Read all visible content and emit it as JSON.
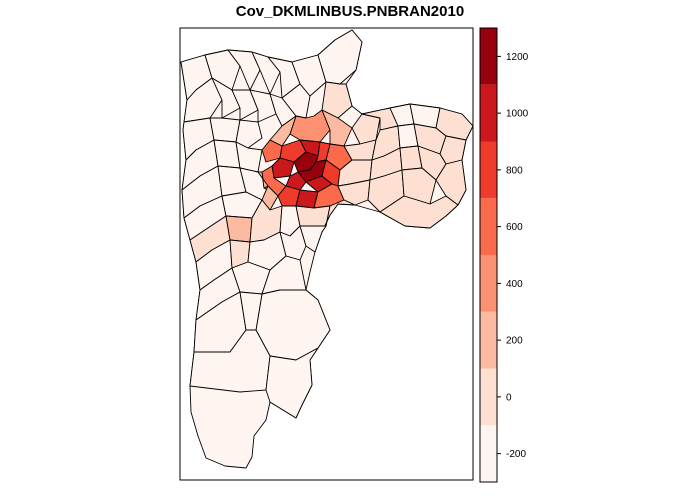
{
  "title": "Cov_DKMLINBUS.PNBRAN2010",
  "legend": {
    "ticks": [
      {
        "label": "1200",
        "value": 1200
      },
      {
        "label": "1000",
        "value": 1000
      },
      {
        "label": "800",
        "value": 800
      },
      {
        "label": "600",
        "value": 600
      },
      {
        "label": "400",
        "value": 400
      },
      {
        "label": "200",
        "value": 200
      },
      {
        "label": "0",
        "value": 0
      },
      {
        "label": "-200",
        "value": -200
      }
    ],
    "bins": [
      {
        "from": -300,
        "to": -100,
        "color": "#fff5f0"
      },
      {
        "from": -100,
        "to": 100,
        "color": "#fee0d2"
      },
      {
        "from": 100,
        "to": 300,
        "color": "#fcbba1"
      },
      {
        "from": 300,
        "to": 500,
        "color": "#fc9272"
      },
      {
        "from": 500,
        "to": 700,
        "color": "#fb6a4a"
      },
      {
        "from": 700,
        "to": 900,
        "color": "#ef3b2c"
      },
      {
        "from": 900,
        "to": 1100,
        "color": "#cb181d"
      },
      {
        "from": 1100,
        "to": 1300,
        "color": "#99000d"
      }
    ]
  }
}
